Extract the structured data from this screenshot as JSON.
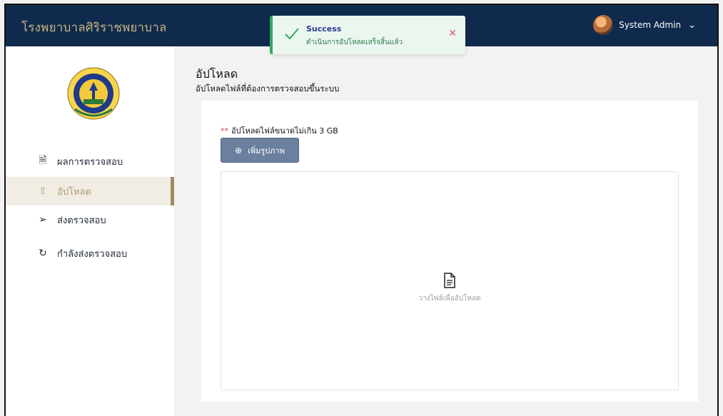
{
  "header": {
    "brand": "โรงพยาบาลศิริราชพยาบาล",
    "user_name": "System Admin",
    "dropdown_icon": "chevron-down-icon",
    "bg_color": "#0f2a4d",
    "brand_color": "#c8b282"
  },
  "toast": {
    "title": "Success",
    "message": "ดำเนินการอัปโหลดเสร็จสิ้นแล้ว",
    "icon": "check-icon",
    "close_icon": "close-icon",
    "accent": "#2eaa63"
  },
  "sidebar": {
    "logo": "hospital-seal-logo",
    "items": [
      {
        "label": "ผลการตรวจสอบ",
        "icon": "document-icon",
        "glyph": "🗎"
      },
      {
        "label": "อัปโหลด",
        "icon": "upload-icon",
        "glyph": "⇧"
      },
      {
        "label": "ส่งตรวจสอบ",
        "icon": "send-icon",
        "glyph": "➢"
      },
      {
        "label": "กำลังส่งตรวจสอบ",
        "icon": "refresh-icon",
        "glyph": "↻"
      }
    ],
    "active_index": 1,
    "active_color": "#b19b6b"
  },
  "main": {
    "title": "อัปโหลด",
    "subtitle": "อัปโหลดไฟล์ที่ต้องการตรวจสอบขึ้นระบบ",
    "note_marker": "**",
    "note": "อัปโหลดไฟล์ขนาดไม่เกิน 3 GB",
    "add_button": "เพิ่มรูปภาพ",
    "add_button_icon": "plus-circle-icon",
    "dropzone_text": "วางไฟล์เพื่ออัปโหลด",
    "dropzone_icon": "file-icon"
  }
}
